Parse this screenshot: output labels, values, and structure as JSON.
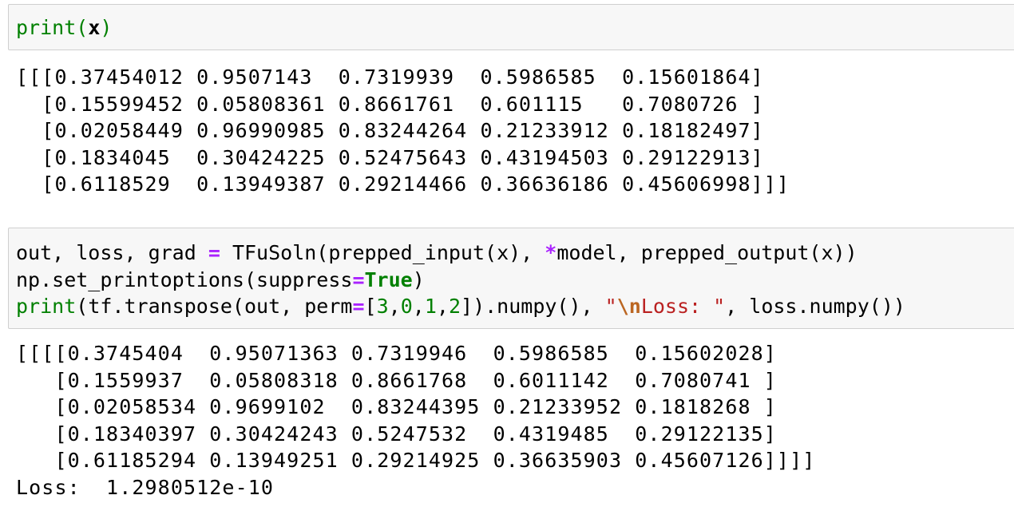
{
  "cells": [
    {
      "input": {
        "tokens": [
          {
            "t": "print",
            "c": "kw-builtin"
          },
          {
            "t": "(",
            "c": "kw-builtin"
          },
          {
            "t": "x",
            "c": "bold"
          },
          {
            "t": ")",
            "c": "kw-builtin"
          }
        ]
      },
      "output_lines": [
        "[[[0.37454012 0.9507143  0.7319939  0.5986585  0.15601864]",
        "  [0.15599452 0.05808361 0.8661761  0.601115   0.7080726 ]",
        "  [0.02058449 0.96990985 0.83244264 0.21233912 0.18182497]",
        "  [0.1834045  0.30424225 0.52475643 0.43194503 0.29122913]",
        "  [0.6118529  0.13949387 0.29214466 0.36636186 0.45606998]]]"
      ]
    },
    {
      "input": {
        "lines": [
          [
            {
              "t": "out, loss, grad ",
              "c": ""
            },
            {
              "t": "=",
              "c": "op"
            },
            {
              "t": " TFuSoln(prepped_input(x), ",
              "c": ""
            },
            {
              "t": "*",
              "c": "op"
            },
            {
              "t": "model, prepped_output(x))",
              "c": ""
            }
          ],
          [
            {
              "t": "np.set_printoptions(suppress",
              "c": ""
            },
            {
              "t": "=",
              "c": "op"
            },
            {
              "t": "True",
              "c": "kw-bold"
            },
            {
              "t": ")",
              "c": ""
            }
          ],
          [
            {
              "t": "print",
              "c": "kw-builtin"
            },
            {
              "t": "(tf.transpose(out, perm",
              "c": ""
            },
            {
              "t": "=",
              "c": "op"
            },
            {
              "t": "[",
              "c": ""
            },
            {
              "t": "3",
              "c": "num"
            },
            {
              "t": ",",
              "c": ""
            },
            {
              "t": "0",
              "c": "num"
            },
            {
              "t": ",",
              "c": ""
            },
            {
              "t": "1",
              "c": "num"
            },
            {
              "t": ",",
              "c": ""
            },
            {
              "t": "2",
              "c": "num"
            },
            {
              "t": "]).numpy(), ",
              "c": ""
            },
            {
              "t": "\"",
              "c": "str"
            },
            {
              "t": "\\n",
              "c": "esc"
            },
            {
              "t": "Loss: \"",
              "c": "str"
            },
            {
              "t": ", loss.numpy())",
              "c": ""
            }
          ]
        ]
      },
      "output_lines": [
        "[[[[0.3745404  0.95071363 0.7319946  0.5986585  0.15602028]",
        "   [0.1559937  0.05808318 0.8661768  0.6011142  0.7080741 ]",
        "   [0.02058534 0.9699102  0.83244395 0.21233952 0.1818268 ]",
        "   [0.18340397 0.30424243 0.5247532  0.4319485  0.29122135]",
        "   [0.61185294 0.13949251 0.29214925 0.36635903 0.45607126]]]]",
        "Loss:  1.2980512e-10"
      ]
    }
  ]
}
